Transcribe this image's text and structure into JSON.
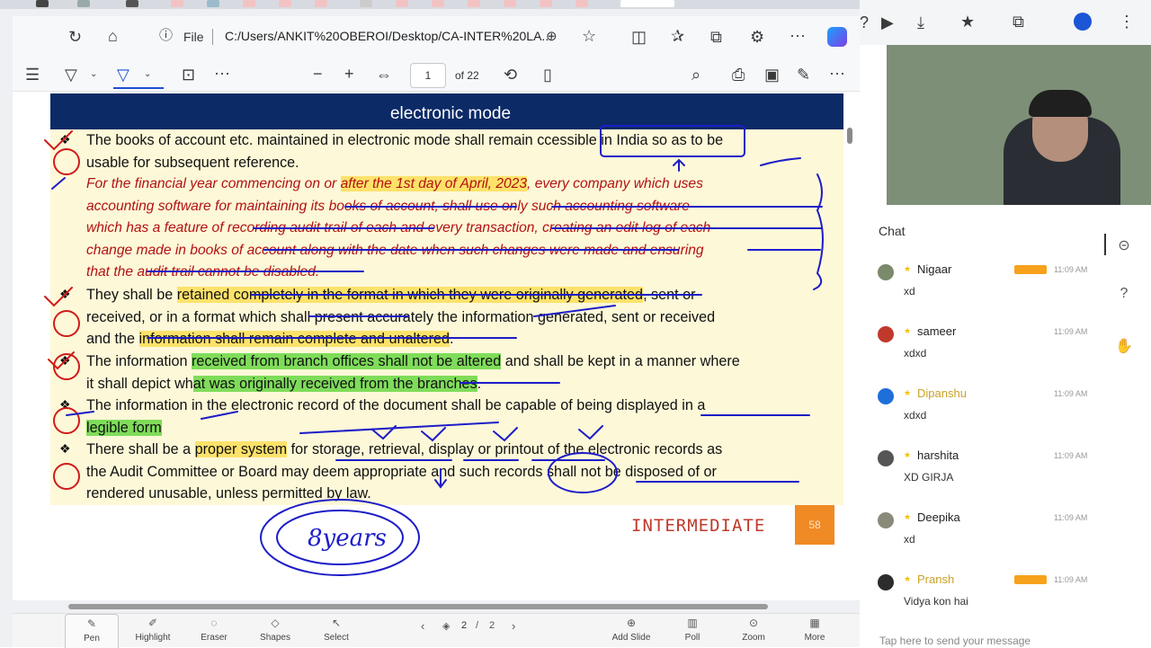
{
  "browser": {
    "file_label": "File",
    "url": "C:/Users/ANKIT%20OBEROI/Desktop/CA-INTER%20LA...",
    "icons": [
      "refresh-icon",
      "home-icon",
      "info-icon",
      "zoom-icon",
      "star-icon",
      "split-icon",
      "favorites-icon",
      "collections-icon",
      "extensions-icon",
      "more-icon",
      "copilot-icon"
    ]
  },
  "pdf_toolbar": {
    "page_value": "1",
    "page_count": "of 22",
    "zoom_out": "−",
    "zoom_in": "+",
    "more": "···"
  },
  "slide": {
    "heading": "electronic mode",
    "para1_a": "The books of account etc. maintained in electronic mode shall remain ",
    "para1_b": "ccessible in India",
    "para1_c": " so as to be",
    "para1_d": "usable for subsequent reference.",
    "red_1a": "For the financial year commencing on or ",
    "red_1b": "after the 1st day of April, 2023",
    "red_1c": ", every company which uses",
    "red_2": "accounting software for maintaining its books of account, shall use only such accounting software",
    "red_3": "which has a feature of recording audit trail of each and every transaction, creating an edit log of each",
    "red_4": "change made in books of account along with the date when such changes were made and ensuring",
    "red_5": "that the audit trail cannot be disabled.",
    "p2_a": "They shall be ",
    "p2_b": "retained completely in the format in which they were originally generated",
    "p2_c": ", sent or",
    "p2_d": "received, or in a format which shall present accurately the information generated, sent or received",
    "p2_e": "and the ",
    "p2_f": "information shall remain complete and unaltered",
    "p2_g": ".",
    "p3_a": "The information ",
    "p3_b": "received from branch offices shall not be altered",
    "p3_c": " and shall be kept in a manner where",
    "p3_d": "it shall depict wh",
    "p3_e": "at was originally received from the branches",
    "p3_f": ".",
    "p4_a": "The information in the electronic record of the document shall be capable of being displayed in a",
    "p4_b": "legible form",
    "p5_a": "There shall be a ",
    "p5_b": "proper system",
    "p5_c": " for storage, retrieval, display or printout of the electronic records as",
    "p5_d": "the Audit Committee or Board may deem appropriate and such records shall not be disposed of or",
    "p5_e": "rendered unusable, unless permitted by law.",
    "footer": "INTERMEDIATE",
    "slide_number": "58",
    "handwritten_note": "8years"
  },
  "bottom_toolbar": {
    "pen": "Pen",
    "highlight": "Highlight",
    "eraser": "Eraser",
    "shapes": "Shapes",
    "select": "Select",
    "page_current": "2",
    "page_sep": "/",
    "page_total": "2",
    "add_slide": "Add Slide",
    "poll": "Poll",
    "zoom": "Zoom",
    "more": "More"
  },
  "chat": {
    "title": "Chat",
    "messages": [
      {
        "name": "Nigaar",
        "time": "11:09 AM",
        "text": "xd",
        "avatar_color": "#7a8a6a",
        "gold": false,
        "badge": true
      },
      {
        "name": "sameer",
        "time": "11:09 AM",
        "text": "xdxd",
        "avatar_color": "#c0392b",
        "gold": false,
        "badge": false
      },
      {
        "name": "Dipanshu",
        "time": "11:09 AM",
        "text": "xdxd",
        "avatar_color": "#1e6fd9",
        "gold": true,
        "badge": false
      },
      {
        "name": "harshita",
        "time": "11:09 AM",
        "text": "XD GIRJA",
        "avatar_color": "#555555",
        "gold": false,
        "badge": false
      },
      {
        "name": "Deepika",
        "time": "11:09 AM",
        "text": "xd",
        "avatar_color": "#8a8a7a",
        "gold": false,
        "badge": false
      },
      {
        "name": "Pransh",
        "time": "11:09 AM",
        "text": "Vidya kon hai",
        "avatar_color": "#2c2c2c",
        "gold": true,
        "badge": true
      }
    ],
    "input_placeholder": "Tap here to send your message"
  }
}
